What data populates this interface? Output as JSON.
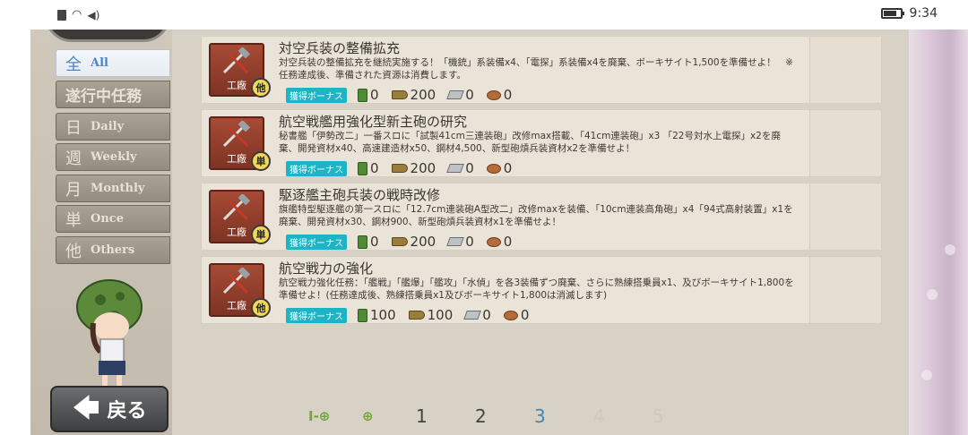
{
  "status": {
    "time": "9:34"
  },
  "back_label": "戻る",
  "tabs": [
    {
      "kanji": "全",
      "en": "All",
      "active": true
    },
    {
      "kanji": "",
      "en": "遂行中任務",
      "active": false
    },
    {
      "kanji": "日",
      "en": "Daily",
      "active": false
    },
    {
      "kanji": "週",
      "en": "Weekly",
      "active": false
    },
    {
      "kanji": "月",
      "en": "Monthly",
      "active": false
    },
    {
      "kanji": "単",
      "en": "Once",
      "active": false
    },
    {
      "kanji": "他",
      "en": "Others",
      "active": false
    }
  ],
  "quests": [
    {
      "category": "工廠",
      "badge": "他",
      "title": "対空兵装の整備拡充",
      "desc": "対空兵装の整備拡充を継続実施する！「機銃」系装備x4、「電探」系装備x4を廃棄、ボーキサイト1,500を準備せよ！　※任務達成後、準備された資源は消費します。",
      "bonus": "獲得ボーナス",
      "fuel": "0",
      "ammo": "200",
      "steel": "0",
      "baux": "0"
    },
    {
      "category": "工廠",
      "badge": "単",
      "title": "航空戦艦用強化型新主砲の研究",
      "desc": "秘書艦「伊勢改二」一番スロに「試製41cm三連装砲」改修max搭載、「41cm連装砲」x3 「22号対水上電探」x2を廃棄、開発資材x40、高速建造材x50、鋼材4,500、新型砲熕兵装資材x2を準備せよ！",
      "bonus": "獲得ボーナス",
      "fuel": "0",
      "ammo": "200",
      "steel": "0",
      "baux": "0"
    },
    {
      "category": "工廠",
      "badge": "単",
      "title": "駆逐艦主砲兵装の戦時改修",
      "desc": "旗艦特型駆逐艦の第一スロに「12.7cm連装砲A型改二」改修maxを装備、「10cm連装高角砲」x4「94式高射装置」x1を廃棄、開発資材x30、鋼材900、新型砲熕兵装資材x1を準備せよ！",
      "bonus": "獲得ボーナス",
      "fuel": "0",
      "ammo": "200",
      "steel": "0",
      "baux": "0"
    },
    {
      "category": "工廠",
      "badge": "他",
      "title": "航空戦力の強化",
      "desc": "航空戦力強化任務：「艦戦」「艦爆」「艦攻」「水偵」を各3装備ずつ廃棄、さらに熟練搭乗員x1、及びボーキサイト1,800を準備せよ！(任務達成後、熟練搭乗員x1及びボーキサイト1,800は消滅します)",
      "bonus": "獲得ボーナス",
      "fuel": "100",
      "ammo": "100",
      "steel": "0",
      "baux": "0"
    }
  ],
  "pager": {
    "first": "I-⊕",
    "prev": "⊕",
    "pages": [
      "1",
      "2",
      "3",
      "4",
      "5"
    ],
    "current": "3"
  }
}
